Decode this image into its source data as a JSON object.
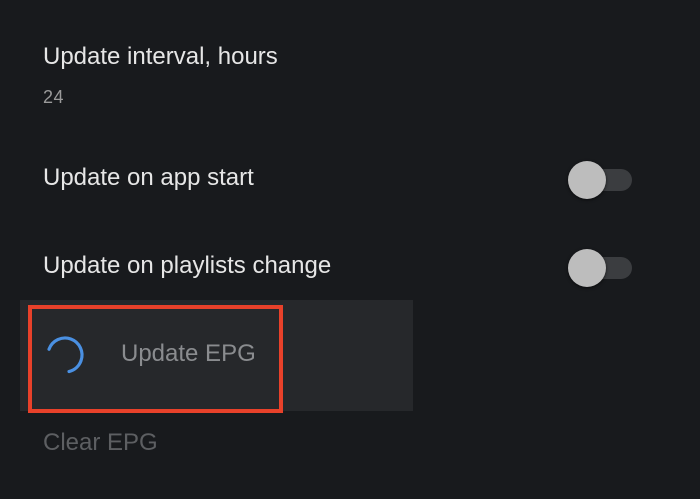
{
  "settings": {
    "update_interval": {
      "title": "Update interval, hours",
      "value": "24"
    },
    "update_on_app_start": {
      "title": "Update on app start",
      "enabled": false
    },
    "update_on_playlists_change": {
      "title": "Update on playlists change",
      "enabled": false
    }
  },
  "actions": {
    "update_epg": {
      "label": "Update EPG",
      "status": "loading"
    },
    "clear_epg": {
      "label": "Clear EPG"
    }
  },
  "colors": {
    "background": "#181a1d",
    "highlight": "#e8412a",
    "spinner": "#4a90e2"
  }
}
